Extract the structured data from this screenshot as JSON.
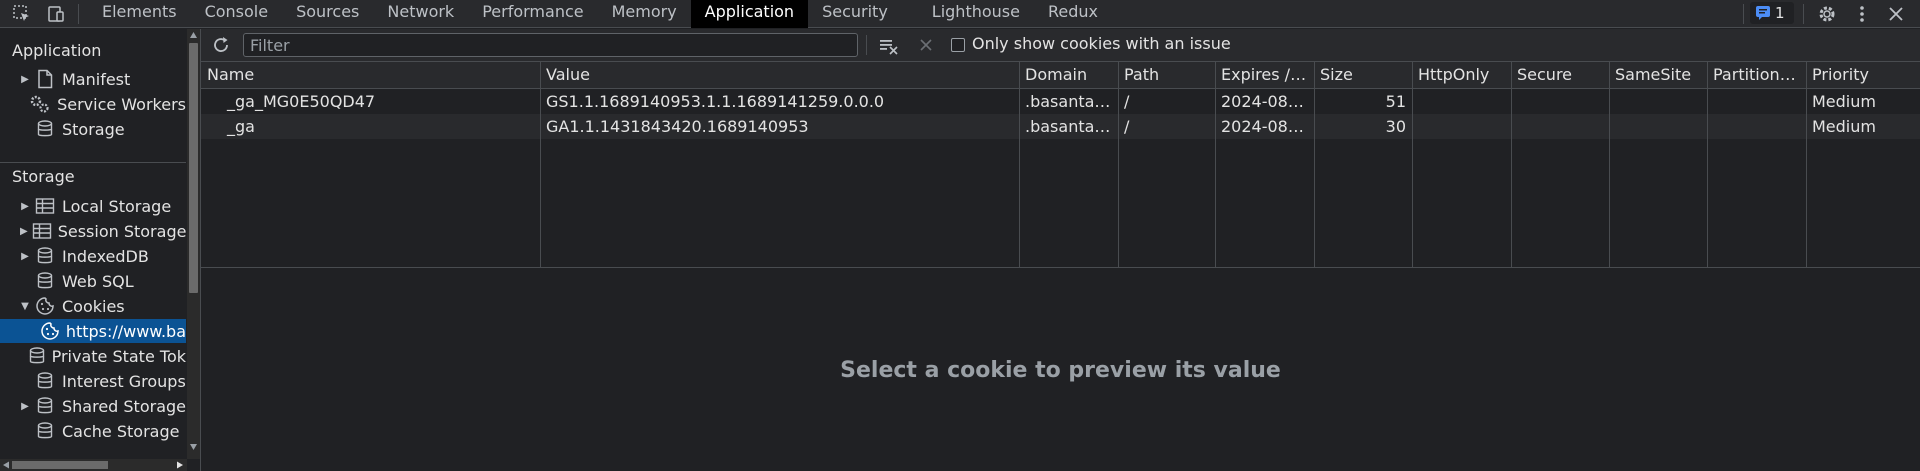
{
  "tabs": [
    "Elements",
    "Console",
    "Sources",
    "Network",
    "Performance",
    "Memory",
    "Application",
    "Security",
    "Lighthouse",
    "Redux"
  ],
  "active_tab_index": 6,
  "issues_count": "1",
  "sidebar": {
    "application_title": "Application",
    "application_items": [
      {
        "label": "Manifest",
        "icon": "file-icon",
        "expandable": true
      },
      {
        "label": "Service Workers",
        "icon": "gears-icon",
        "expandable": false
      },
      {
        "label": "Storage",
        "icon": "database-icon",
        "expandable": false
      }
    ],
    "storage_title": "Storage",
    "storage_items": [
      {
        "label": "Local Storage",
        "icon": "table-icon",
        "expandable": true,
        "expanded": false
      },
      {
        "label": "Session Storage",
        "icon": "table-icon",
        "expandable": true,
        "expanded": false
      },
      {
        "label": "IndexedDB",
        "icon": "database-icon",
        "expandable": true,
        "expanded": false
      },
      {
        "label": "Web SQL",
        "icon": "database-icon",
        "expandable": false
      },
      {
        "label": "Cookies",
        "icon": "cookie-icon",
        "expandable": true,
        "expanded": true
      },
      {
        "label": "https://www.ba",
        "icon": "cookie-icon",
        "child": true,
        "selected": true
      },
      {
        "label": "Private State Tok",
        "icon": "database-icon",
        "expandable": false
      },
      {
        "label": "Interest Groups",
        "icon": "database-icon",
        "expandable": false
      },
      {
        "label": "Shared Storage",
        "icon": "database-icon",
        "expandable": true,
        "expanded": false
      },
      {
        "label": "Cache Storage",
        "icon": "database-icon",
        "expandable": false
      }
    ]
  },
  "toolbar": {
    "filter_placeholder": "Filter",
    "only_issues_label": "Only show cookies with an issue"
  },
  "table": {
    "columns": [
      "Name",
      "Value",
      "Domain",
      "Path",
      "Expires / ...",
      "Size",
      "HttpOnly",
      "Secure",
      "SameSite",
      "Partition ...",
      "Priority"
    ],
    "rows": [
      [
        "_ga_MG0E50QD47",
        "GS1.1.1689140953.1.1.1689141259.0.0.0",
        ".basantar...",
        "/",
        "2024-08-...",
        "51",
        "",
        "",
        "",
        "",
        "Medium"
      ],
      [
        "_ga",
        "GA1.1.1431843420.1689140953",
        ".basantar...",
        "/",
        "2024-08-...",
        "30",
        "",
        "",
        "",
        "",
        "Medium"
      ]
    ]
  },
  "preview_message": "Select a cookie to preview its value",
  "colors": {
    "accent_selected": "#0b5394",
    "active_tab_bg": "#000000",
    "panel_bg": "#202124",
    "toolbar_bg": "#292a2d",
    "issue_icon": "#4c8df6"
  }
}
